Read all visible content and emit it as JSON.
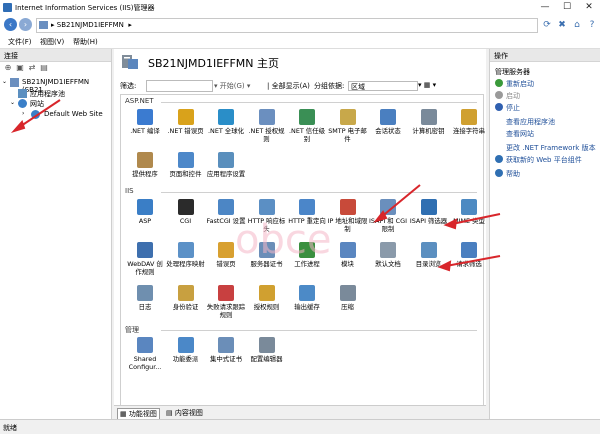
{
  "window": {
    "title": "Internet Information Services (IIS)管理器"
  },
  "address": {
    "path": "SB21NJMD1IEFFMN",
    "separator": "▸"
  },
  "menu": [
    "文件(F)",
    "视图(V)",
    "帮助(H)"
  ],
  "left": {
    "header": "连接",
    "tree": {
      "server": "SB21NJMD1IEFFMN (SB21",
      "app_pools": "应用程序池",
      "sites": "网站",
      "default_site": "Default Web Site"
    }
  },
  "main": {
    "title": "SB21NJMD1IEFFMN 主页",
    "filter": {
      "label": "筛选:",
      "start": "开始(G)",
      "show_all": "全部显示(A)",
      "group_by": "分组依据:",
      "group_value": "区域"
    },
    "sections": {
      "aspnet": {
        "label": "ASP.NET",
        "items": [
          {
            "label": ".NET 编译",
            "color": "#3b7bd0"
          },
          {
            "label": ".NET 错误页",
            "color": "#d9a21b"
          },
          {
            "label": ".NET 全球化",
            "color": "#2a8ec8"
          },
          {
            "label": ".NET 授权规则",
            "color": "#6b8fbf"
          },
          {
            "label": ".NET 信任级别",
            "color": "#3a8f55"
          },
          {
            "label": "SMTP 电子邮件",
            "color": "#c8a84a"
          },
          {
            "label": "会话状态",
            "color": "#4a7fc0"
          },
          {
            "label": "计算机密钥",
            "color": "#7a8a9a"
          },
          {
            "label": "连接字符串",
            "color": "#d0a030"
          },
          {
            "label": "提供程序",
            "color": "#b0894d"
          },
          {
            "label": "页面和控件",
            "color": "#4d88c9"
          },
          {
            "label": "应用程序设置",
            "color": "#5a8fbd"
          }
        ]
      },
      "iis": {
        "label": "IIS",
        "items": [
          {
            "label": "ASP",
            "color": "#3a7ec6"
          },
          {
            "label": "CGI",
            "color": "#2b2b2b"
          },
          {
            "label": "FastCGI 设置",
            "color": "#4c86c5"
          },
          {
            "label": "HTTP 响应标头",
            "color": "#5b8fc4"
          },
          {
            "label": "HTTP 重定向",
            "color": "#4b86c9"
          },
          {
            "label": "IP 地址和域限制",
            "color": "#c84a3a"
          },
          {
            "label": "ISAPI 和 CGI 限制",
            "color": "#6a8fbd"
          },
          {
            "label": "ISAPI 筛选器",
            "color": "#2f6fb2"
          },
          {
            "label": "MIME 类型",
            "color": "#4d8ac2"
          },
          {
            "label": "WebDAV 创作规则",
            "color": "#3e6fae"
          },
          {
            "label": "处理程序映射",
            "color": "#5c91c7"
          },
          {
            "label": "错误页",
            "color": "#d8a030"
          },
          {
            "label": "服务器证书",
            "color": "#6b8eb8"
          },
          {
            "label": "工作进程",
            "color": "#3b8f3f"
          },
          {
            "label": "模块",
            "color": "#5a86c0"
          },
          {
            "label": "默认文档",
            "color": "#8a9aaa"
          },
          {
            "label": "目录浏览",
            "color": "#5b8fc0"
          },
          {
            "label": "请求筛选",
            "color": "#4a7fc0"
          },
          {
            "label": "日志",
            "color": "#6f8faf"
          },
          {
            "label": "身份验证",
            "color": "#c8a040"
          },
          {
            "label": "失败请求跟踪规则",
            "color": "#c84040"
          },
          {
            "label": "授权规则",
            "color": "#d0a030"
          },
          {
            "label": "输出缓存",
            "color": "#4c8ac7"
          },
          {
            "label": "压缩",
            "color": "#7a8a9a"
          }
        ]
      },
      "manage": {
        "label": "管理",
        "items": [
          {
            "label": "Shared Configur...",
            "color": "#5a86c0"
          },
          {
            "label": "功能委派",
            "color": "#4b88c8"
          },
          {
            "label": "集中式证书",
            "color": "#6b8eb8"
          },
          {
            "label": "配置编辑器",
            "color": "#7a8a9a"
          }
        ]
      }
    },
    "tabs": {
      "features": "功能视图",
      "content": "内容视图"
    }
  },
  "right": {
    "header": "操作",
    "manage_title": "管理服务器",
    "actions": [
      {
        "label": "重新启动",
        "dim": false,
        "icon": "restart-icon"
      },
      {
        "label": "启动",
        "dim": true,
        "icon": "start-icon"
      },
      {
        "label": "停止",
        "dim": false,
        "icon": "stop-icon"
      },
      {
        "label": "查看应用程序池",
        "dim": false,
        "icon": ""
      },
      {
        "label": "查看网站",
        "dim": false,
        "icon": ""
      },
      {
        "label": "更改 .NET Framework 版本",
        "dim": false,
        "icon": ""
      },
      {
        "label": "获取新的 Web 平台组件",
        "dim": false,
        "icon": "web-platform-icon"
      },
      {
        "label": "帮助",
        "dim": false,
        "icon": "help-icon"
      }
    ]
  },
  "status": {
    "text": "就绪"
  },
  "watermark": "obce"
}
